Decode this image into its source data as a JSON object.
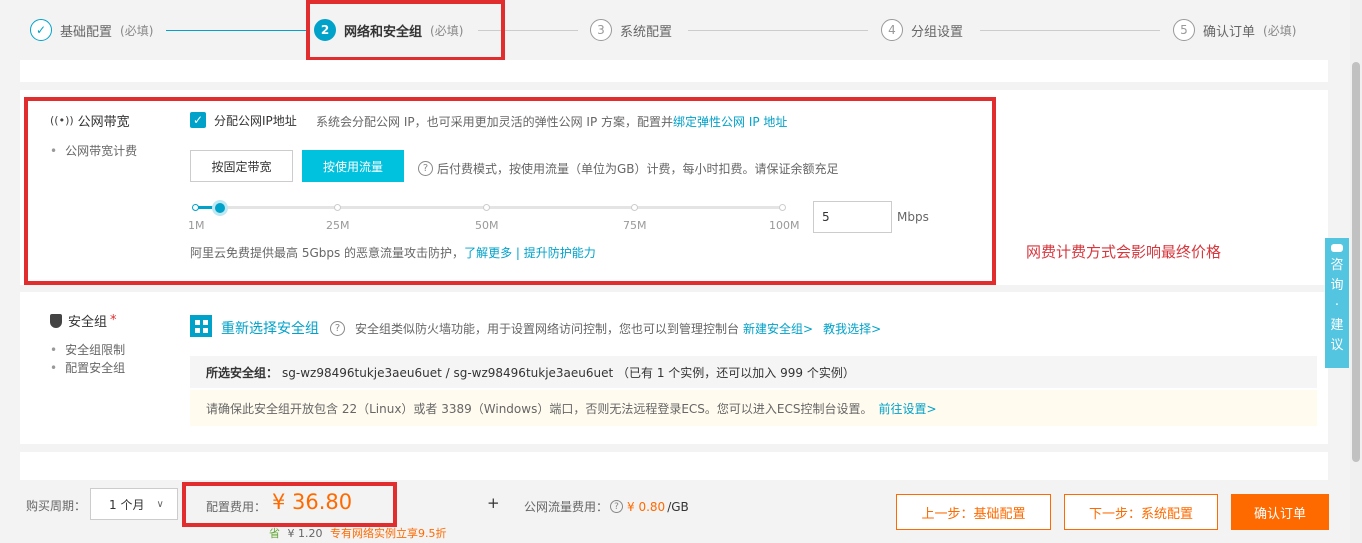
{
  "steps": [
    {
      "num": "✓",
      "label": "基础配置",
      "req": "(必填)"
    },
    {
      "num": "2",
      "label": "网络和安全组",
      "req": "(必填)"
    },
    {
      "num": "3",
      "label": "系统配置",
      "req": ""
    },
    {
      "num": "4",
      "label": "分组设置",
      "req": ""
    },
    {
      "num": "5",
      "label": "确认订单",
      "req": "(必填)"
    }
  ],
  "bandwidth": {
    "title": "公网带宽",
    "sub": "公网带宽计费",
    "checkbox_label": "分配公网IP地址",
    "checkbox_desc": "系统会分配公网 IP，也可采用更加灵活的弹性公网 IP 方案，配置并",
    "checkbox_link": "绑定弹性公网 IP 地址",
    "btn_fixed": "按固定带宽",
    "btn_traffic": "按使用流量",
    "traffic_help": "后付费模式，按使用流量（单位为GB）计费，每小时扣费。请保证余额充足",
    "ticks": [
      "1M",
      "25M",
      "50M",
      "75M",
      "100M"
    ],
    "value": "5",
    "unit": "Mbps",
    "slider_fraction": 0.04,
    "ddos_text": "阿里云免费提供最高 5Gbps 的恶意流量攻击防护，",
    "ddos_link1": "了解更多",
    "ddos_sep": "|",
    "ddos_link2": "提升防护能力"
  },
  "annotation": "网费计费方式会影响最终价格",
  "security": {
    "title": "安全组",
    "required": "*",
    "sub1": "安全组限制",
    "sub2": "配置安全组",
    "reselect": "重新选择安全组",
    "desc": "安全组类似防火墙功能，用于设置网络访问控制，您也可以到管理控制台",
    "link_new": "新建安全组>",
    "link_teach": "教我选择>",
    "selected_label": "所选安全组：",
    "selected_value": "sg-wz98496tukje3aeu6uet / sg-wz98496tukje3aeu6uet （已有 1 个实例，还可以加入 999 个实例）",
    "warning": "请确保此安全组开放包含 22（Linux）或者 3389（Windows）端口，否则无法远程登录ECS。您可以进入ECS控制台设置。",
    "warning_link": "前往设置>"
  },
  "side_float": [
    "咨",
    "询",
    "·",
    "建",
    "议"
  ],
  "footer": {
    "period_label": "购买周期：",
    "period_value": "1 个月",
    "cost_label": "配置费用：",
    "cost_value": "¥ 36.80",
    "save_amount": "¥ 1.20",
    "save_promo": "专有网络实例立享9.5折",
    "plus": "+",
    "traffic_label": "公网流量费用：",
    "traffic_value": "¥ 0.80",
    "traffic_unit": "/GB",
    "prev_btn": "上一步：基础配置",
    "next_btn": "下一步：系统配置",
    "confirm_btn": "确认订单"
  },
  "colors": {
    "accent": "#00a2ca",
    "red_box": "#e12d2d",
    "orange": "#ff6a00"
  }
}
